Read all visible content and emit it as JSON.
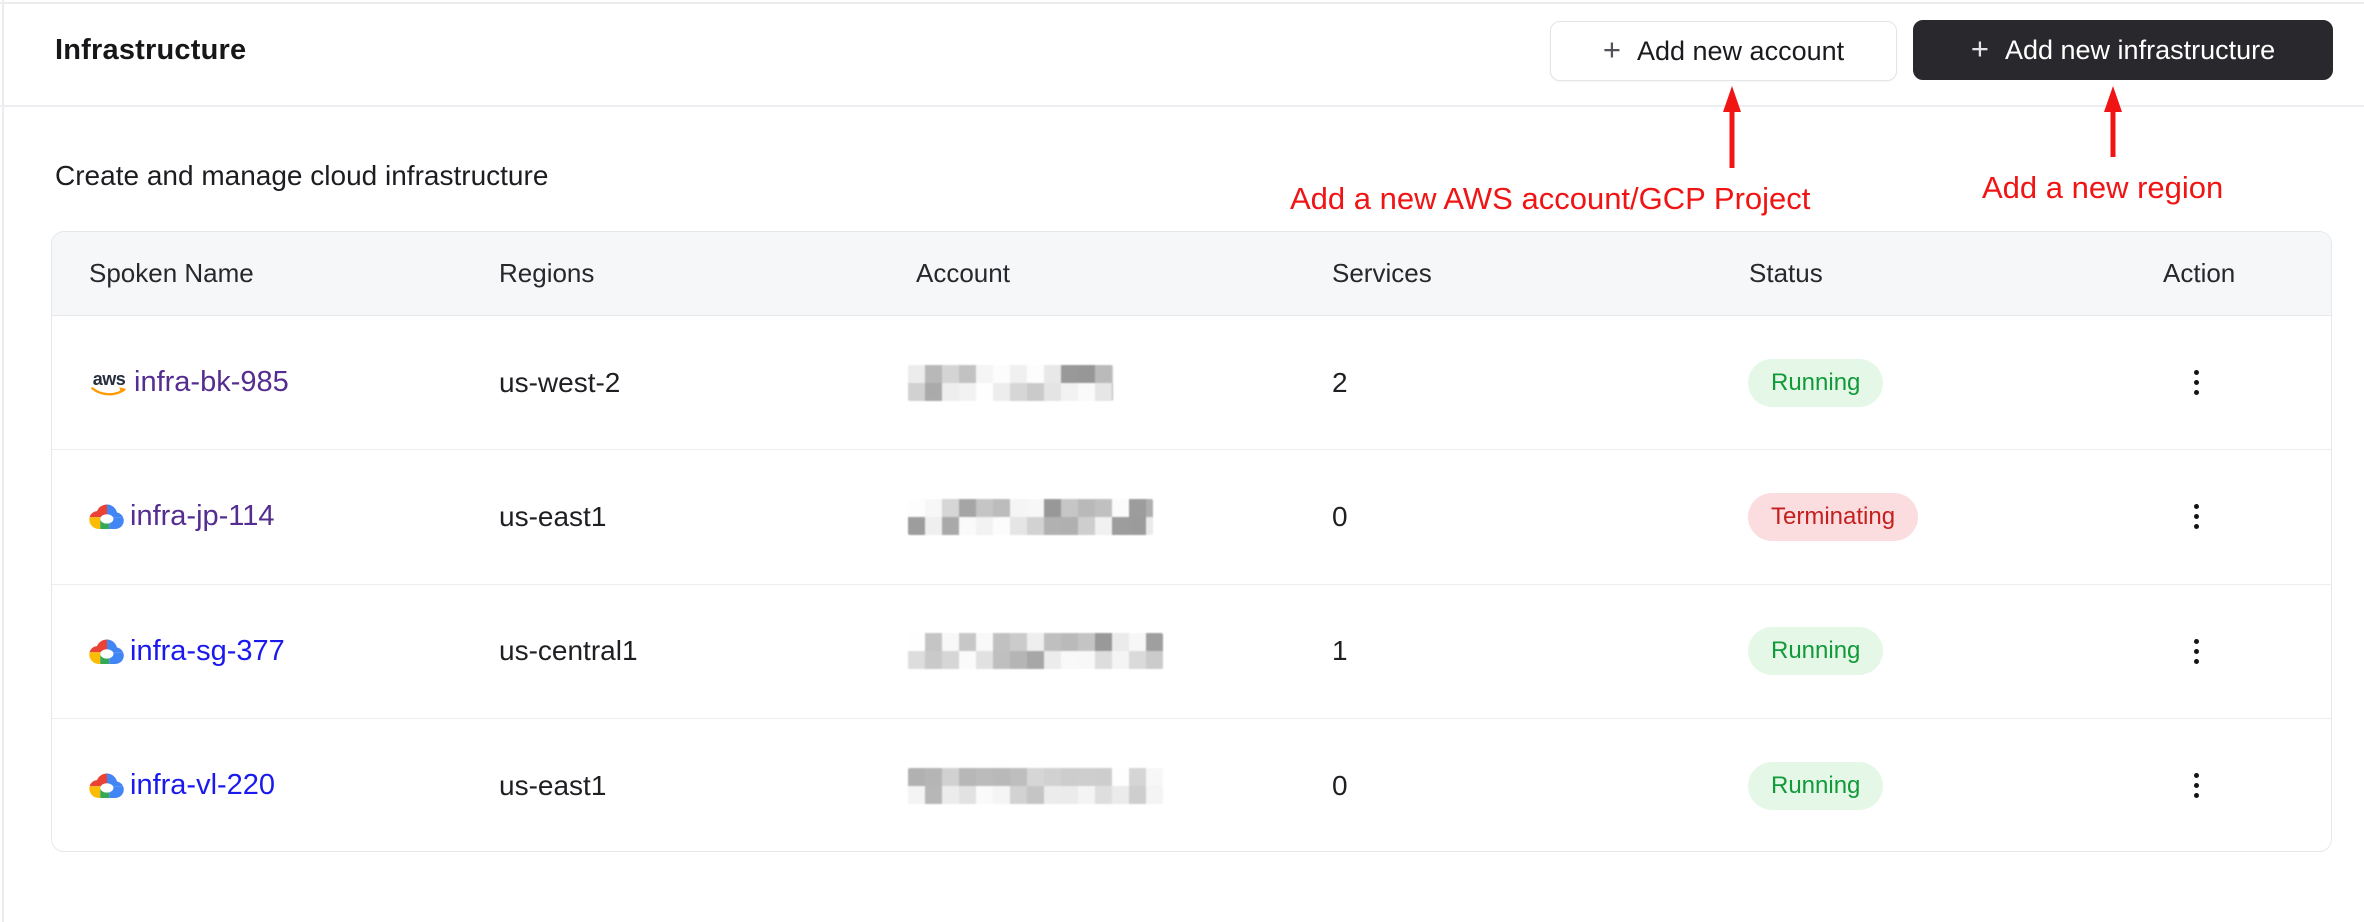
{
  "page": {
    "title": "Infrastructure",
    "subtitle": "Create and manage cloud infrastructure"
  },
  "toolbar": {
    "plus": "+",
    "add_account_label": "Add new account",
    "add_infrastructure_label": "Add new infrastructure"
  },
  "annotations": {
    "account_note": "Add a new AWS account/GCP Project",
    "region_note": "Add a new region",
    "arrow_color": "#f01414"
  },
  "table": {
    "columns": [
      "Spoken Name",
      "Regions",
      "Account",
      "Services",
      "Status",
      "Action"
    ],
    "rows": [
      {
        "provider_icon": "aws-icon",
        "name": "infra-bk-985",
        "link_state": "visited",
        "region": "us-west-2",
        "account": "redacted",
        "services": "2",
        "status": "Running"
      },
      {
        "provider_icon": "gcp-icon",
        "name": "infra-jp-114",
        "link_state": "visited",
        "region": "us-east1",
        "account": "redacted",
        "services": "0",
        "status": "Terminating"
      },
      {
        "provider_icon": "gcp-icon",
        "name": "infra-sg-377",
        "link_state": "unvisited",
        "region": "us-central1",
        "account": "redacted",
        "services": "1",
        "status": "Running"
      },
      {
        "provider_icon": "gcp-icon",
        "name": "infra-vl-220",
        "link_state": "unvisited",
        "region": "us-east1",
        "account": "redacted",
        "services": "0",
        "status": "Running"
      }
    ]
  },
  "icons": {
    "kebab": "kebab-menu-icon",
    "plus": "plus-icon",
    "aws": "aws-logo-icon",
    "gcp": "google-cloud-logo-icon"
  },
  "colors": {
    "link_visited": "#552d90",
    "link_unvisited": "#1a1aee",
    "badge_running_bg": "#e5f8e7",
    "badge_running_text": "#12993a",
    "badge_terminating_bg": "#fbdde0",
    "badge_terminating_text": "#c51f1f",
    "primary_button_bg": "#29292d",
    "annotation_red": "#f01414",
    "aws_orange": "#ff9900",
    "aws_navy": "#252f3e"
  }
}
